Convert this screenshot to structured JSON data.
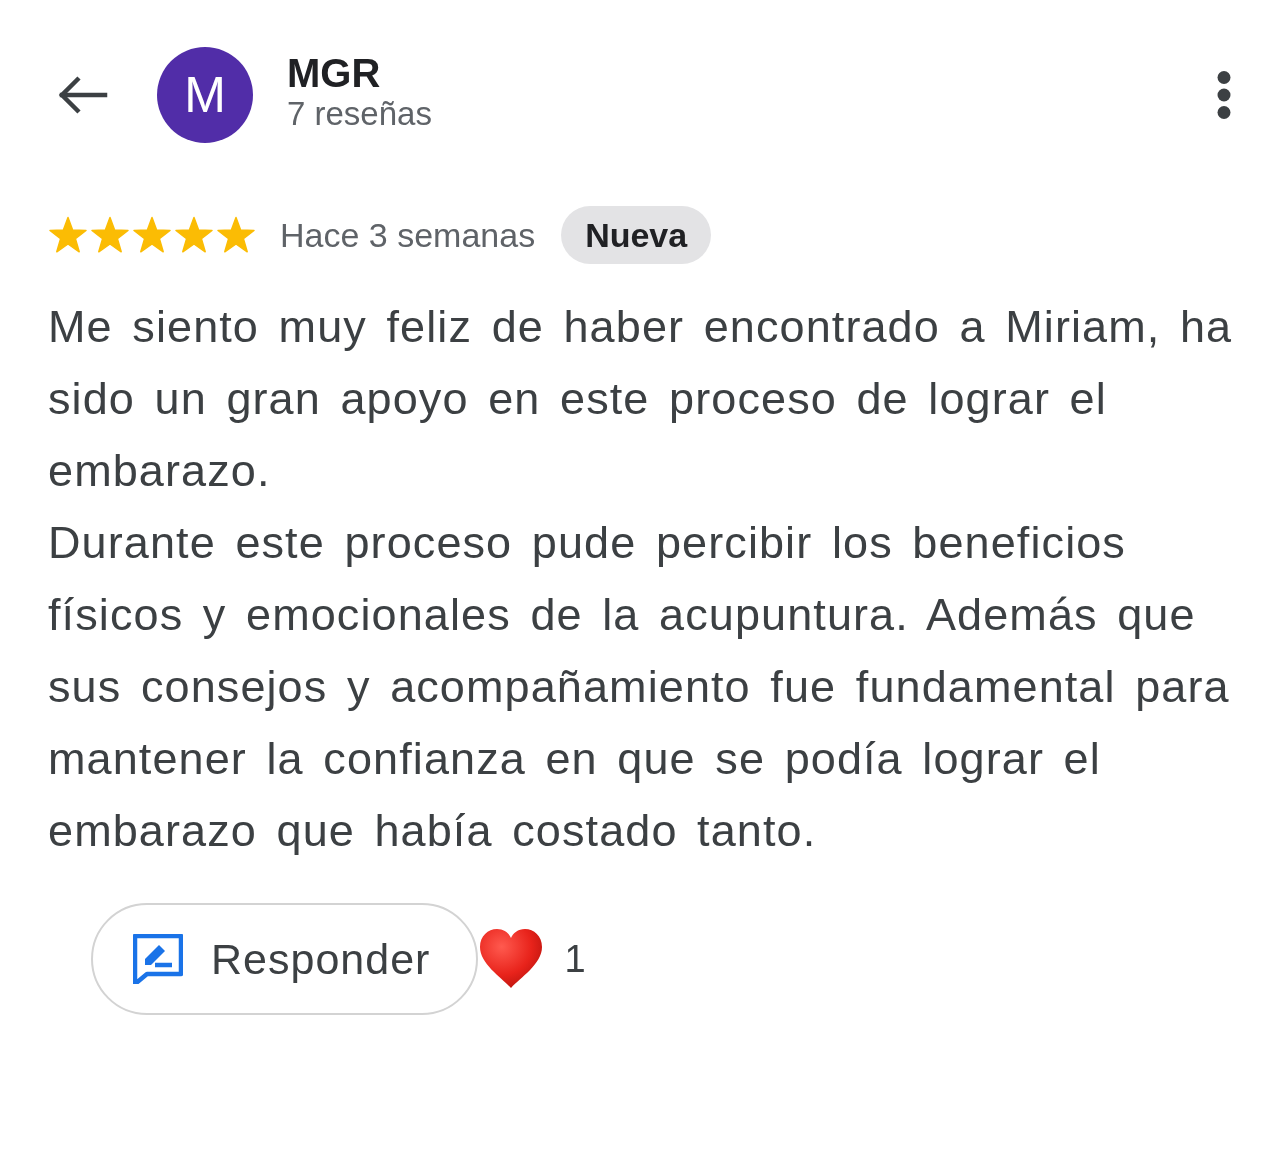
{
  "reviewer": {
    "initial": "M",
    "name": "MGR",
    "reviews": "7 reseñas"
  },
  "review": {
    "stars": 5,
    "time": "Hace 3 semanas",
    "badge": "Nueva",
    "paragraphs": [
      "Me siento muy feliz de haber encontrado a Miriam, ha sido un gran apoyo en este proceso de lograr el embarazo.",
      "Durante este proceso pude percibir los beneficios físicos y emocionales de la acupuntura. Además que sus consejos y acompañamiento fue fundamental para mantener la confianza en que se podía lograr el embarazo que había costado tanto."
    ]
  },
  "actions": {
    "reply_button": "Responder",
    "reaction_count": "1"
  }
}
